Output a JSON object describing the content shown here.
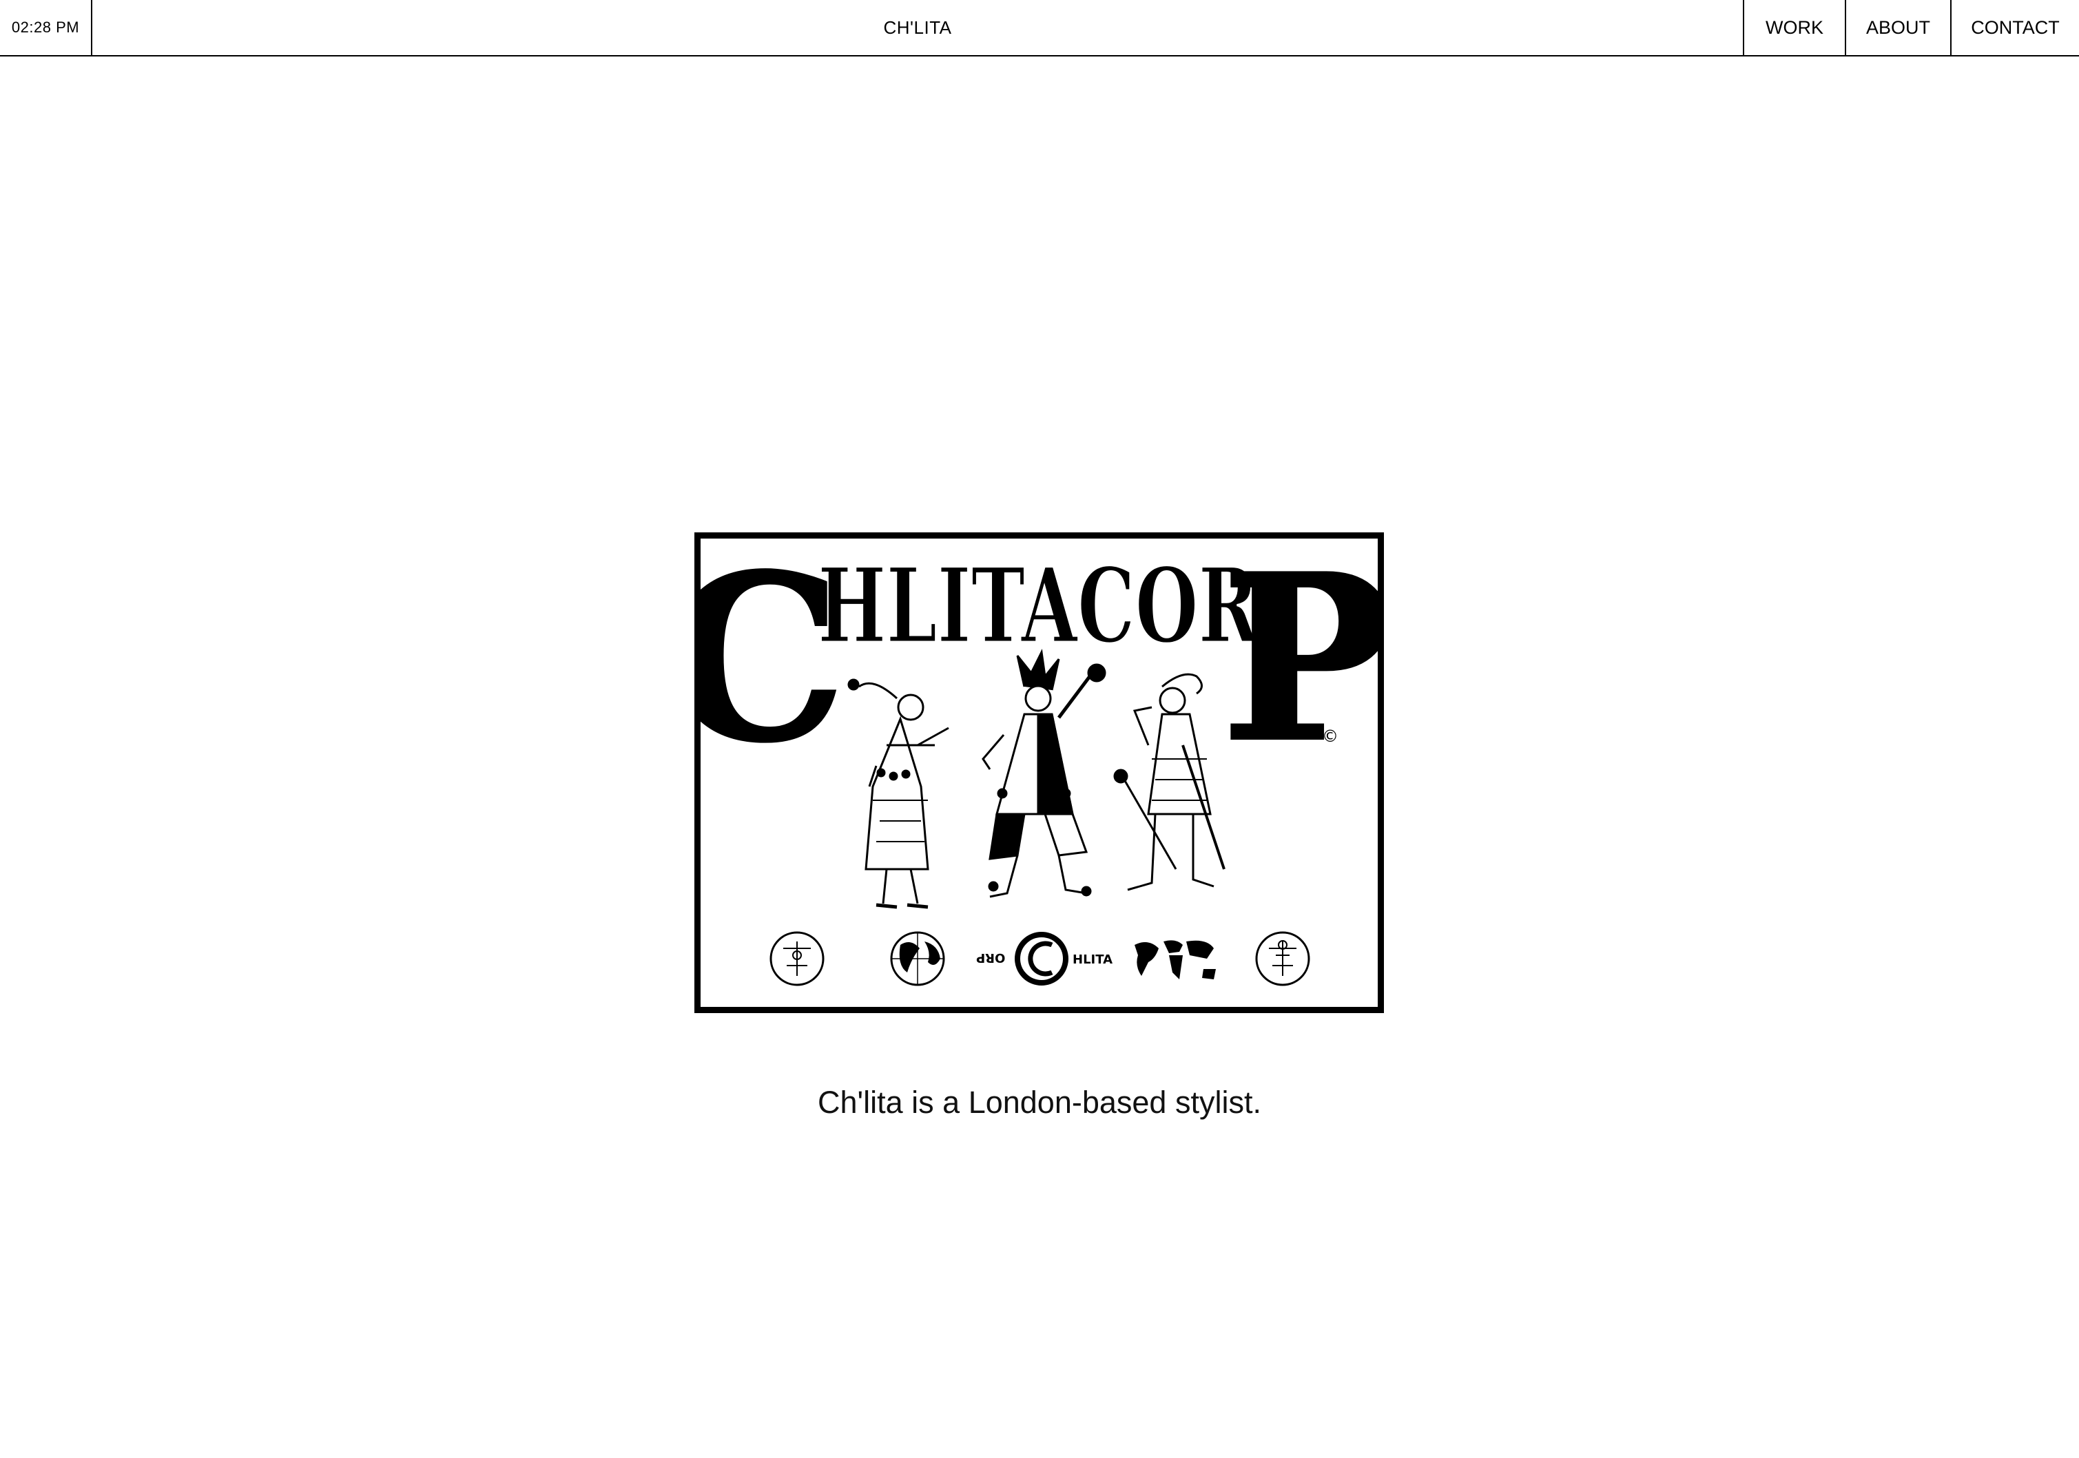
{
  "header": {
    "time": "02:28 PM",
    "brand": "CH'LITA",
    "nav": [
      {
        "label": "WORK"
      },
      {
        "label": "ABOUT"
      },
      {
        "label": "CONTACT"
      }
    ]
  },
  "logo": {
    "wordmark": "CHLITACORP",
    "copyright_mark": "©",
    "emblem_text_left": "ORP",
    "emblem_text_right": "HLITA",
    "bottom_icons": [
      "sigil-icon",
      "globe-icon",
      "chlita-corp-emblem-icon",
      "world-map-icon",
      "sigil-icon"
    ]
  },
  "main": {
    "tagline": "Ch'lita is a London-based stylist."
  },
  "colors": {
    "foreground": "#000000",
    "background": "#ffffff"
  }
}
